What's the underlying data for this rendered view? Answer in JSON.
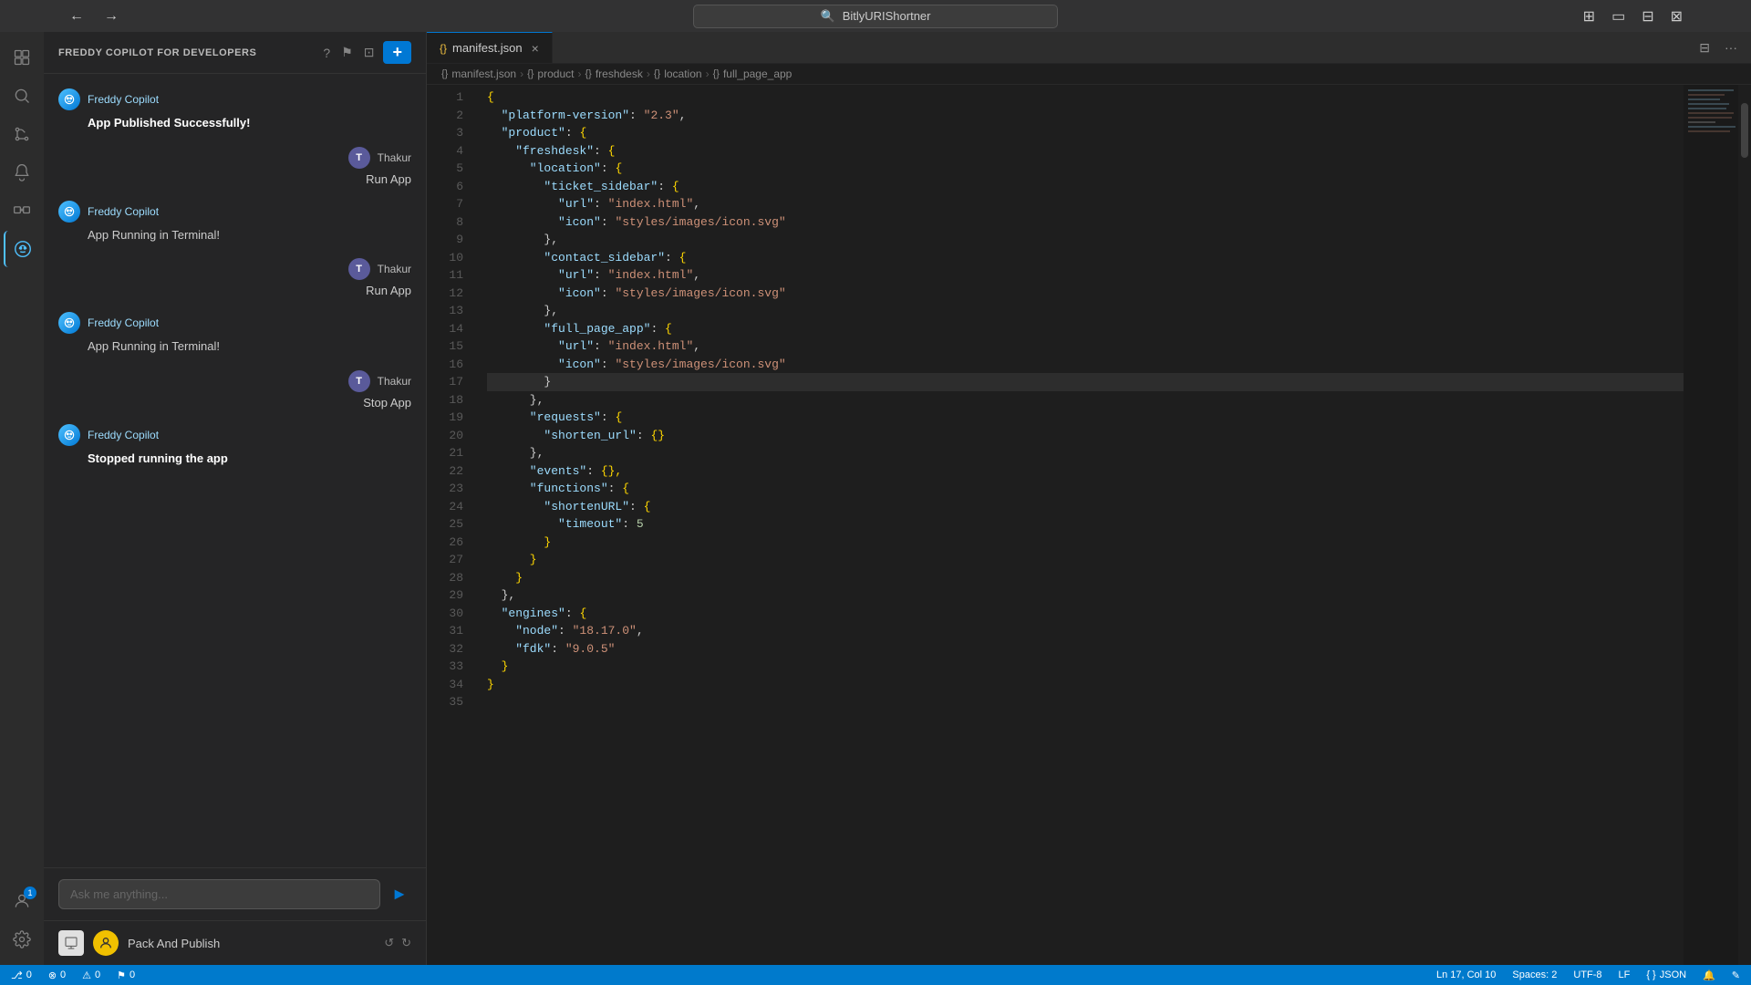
{
  "titlebar": {
    "back_label": "←",
    "forward_label": "→",
    "search_text": "BitlyURIShortner",
    "layout_icons": [
      "⊞",
      "▭",
      "⊟",
      "⊠"
    ]
  },
  "activity_bar": {
    "icons": [
      {
        "name": "explorer",
        "symbol": "⧉",
        "active": false
      },
      {
        "name": "search",
        "symbol": "🔍",
        "active": false
      },
      {
        "name": "source-control",
        "symbol": "⑂",
        "active": false
      },
      {
        "name": "run-debug",
        "symbol": "▷",
        "active": false
      },
      {
        "name": "extensions",
        "symbol": "⊞",
        "active": false
      },
      {
        "name": "copilot",
        "symbol": "◈",
        "active": true
      }
    ],
    "bottom_icons": [
      {
        "name": "accounts",
        "symbol": "👤",
        "badge": "1"
      },
      {
        "name": "settings",
        "symbol": "⚙"
      }
    ]
  },
  "sidebar": {
    "title": "FREDDY COPILOT FOR DEVELOPERS",
    "header_icons": [
      "?",
      "⚑",
      "⊡"
    ],
    "add_button": "+",
    "messages": [
      {
        "type": "bot",
        "avatar": "F",
        "name": "Freddy Copilot",
        "text": "App Published Successfully!",
        "bold": true
      },
      {
        "type": "user",
        "avatar": "T",
        "name": "Thakur",
        "action": "Run App"
      },
      {
        "type": "bot",
        "avatar": "F",
        "name": "Freddy Copilot",
        "text": "App Running in Terminal!",
        "bold": false
      },
      {
        "type": "user",
        "avatar": "T",
        "name": "Thakur",
        "action": "Run App"
      },
      {
        "type": "bot",
        "avatar": "F",
        "name": "Freddy Copilot",
        "text": "App Running in Terminal!",
        "bold": false
      },
      {
        "type": "user",
        "avatar": "T",
        "name": "Thakur",
        "action": "Stop App"
      },
      {
        "type": "bot",
        "avatar": "F",
        "name": "Freddy Copilot",
        "text": "Stopped running the app",
        "bold": true
      }
    ],
    "input_placeholder": "Ask me anything...",
    "pack_label": "Pack And Publish"
  },
  "tab": {
    "icon": "{}",
    "filename": "manifest.json",
    "close": "×"
  },
  "breadcrumb": [
    {
      "icon": "{}",
      "label": "manifest.json"
    },
    {
      "icon": "{}",
      "label": "product"
    },
    {
      "icon": "{}",
      "label": "freshdesk"
    },
    {
      "icon": "{}",
      "label": "location"
    },
    {
      "icon": "{}",
      "label": "full_page_app"
    }
  ],
  "code_lines": [
    {
      "num": 1,
      "content": [
        {
          "t": "brace",
          "v": "{"
        }
      ]
    },
    {
      "num": 2,
      "content": [
        {
          "t": "key",
          "v": "  \"platform-version\""
        },
        {
          "t": "punct",
          "v": ": "
        },
        {
          "t": "string",
          "v": "\"2.3\""
        },
        {
          "t": "punct",
          "v": ","
        }
      ]
    },
    {
      "num": 3,
      "content": [
        {
          "t": "key",
          "v": "  \"product\""
        },
        {
          "t": "punct",
          "v": ": "
        },
        {
          "t": "brace",
          "v": "{"
        }
      ]
    },
    {
      "num": 4,
      "content": [
        {
          "t": "key",
          "v": "    \"freshdesk\""
        },
        {
          "t": "punct",
          "v": ": "
        },
        {
          "t": "brace",
          "v": "{"
        }
      ]
    },
    {
      "num": 5,
      "content": [
        {
          "t": "key",
          "v": "      \"location\""
        },
        {
          "t": "punct",
          "v": ": "
        },
        {
          "t": "brace",
          "v": "{"
        }
      ]
    },
    {
      "num": 6,
      "content": [
        {
          "t": "key",
          "v": "        \"ticket_sidebar\""
        },
        {
          "t": "punct",
          "v": ": "
        },
        {
          "t": "brace",
          "v": "{"
        }
      ]
    },
    {
      "num": 7,
      "content": [
        {
          "t": "key",
          "v": "          \"url\""
        },
        {
          "t": "punct",
          "v": ": "
        },
        {
          "t": "string",
          "v": "\"index.html\""
        },
        {
          "t": "punct",
          "v": ","
        }
      ]
    },
    {
      "num": 8,
      "content": [
        {
          "t": "key",
          "v": "          \"icon\""
        },
        {
          "t": "punct",
          "v": ": "
        },
        {
          "t": "string",
          "v": "\"styles/images/icon.svg\""
        }
      ]
    },
    {
      "num": 9,
      "content": [
        {
          "t": "brace",
          "v": "        "
        },
        {
          "t": "punct",
          "v": "},"
        }
      ]
    },
    {
      "num": 10,
      "content": [
        {
          "t": "key",
          "v": "        \"contact_sidebar\""
        },
        {
          "t": "punct",
          "v": ": "
        },
        {
          "t": "brace",
          "v": "{"
        }
      ]
    },
    {
      "num": 11,
      "content": [
        {
          "t": "key",
          "v": "          \"url\""
        },
        {
          "t": "punct",
          "v": ": "
        },
        {
          "t": "string",
          "v": "\"index.html\""
        },
        {
          "t": "punct",
          "v": ","
        }
      ]
    },
    {
      "num": 12,
      "content": [
        {
          "t": "key",
          "v": "          \"icon\""
        },
        {
          "t": "punct",
          "v": ": "
        },
        {
          "t": "string",
          "v": "\"styles/images/icon.svg\""
        }
      ]
    },
    {
      "num": 13,
      "content": [
        {
          "t": "punct",
          "v": "        },"
        }
      ]
    },
    {
      "num": 14,
      "content": [
        {
          "t": "key",
          "v": "        \"full_page_app\""
        },
        {
          "t": "punct",
          "v": ": "
        },
        {
          "t": "brace",
          "v": "{"
        }
      ]
    },
    {
      "num": 15,
      "content": [
        {
          "t": "key",
          "v": "          \"url\""
        },
        {
          "t": "punct",
          "v": ": "
        },
        {
          "t": "string",
          "v": "\"index.html\""
        },
        {
          "t": "punct",
          "v": ","
        }
      ]
    },
    {
      "num": 16,
      "content": [
        {
          "t": "key",
          "v": "          \"icon\""
        },
        {
          "t": "punct",
          "v": ": "
        },
        {
          "t": "string",
          "v": "\"styles/images/icon.svg\""
        }
      ]
    },
    {
      "num": 17,
      "content": [
        {
          "t": "brace",
          "v": "        "
        },
        {
          "t": "punct",
          "v": "}"
        }
      ]
    },
    {
      "num": 18,
      "content": [
        {
          "t": "punct",
          "v": "      },"
        }
      ]
    },
    {
      "num": 19,
      "content": [
        {
          "t": "key",
          "v": "      \"requests\""
        },
        {
          "t": "punct",
          "v": ": "
        },
        {
          "t": "brace",
          "v": "{"
        }
      ]
    },
    {
      "num": 20,
      "content": [
        {
          "t": "key",
          "v": "        \"shorten_url\""
        },
        {
          "t": "punct",
          "v": ": "
        },
        {
          "t": "brace",
          "v": "{}"
        }
      ]
    },
    {
      "num": 21,
      "content": [
        {
          "t": "punct",
          "v": "      },"
        }
      ]
    },
    {
      "num": 22,
      "content": [
        {
          "t": "key",
          "v": "      \"events\""
        },
        {
          "t": "punct",
          "v": ": "
        },
        {
          "t": "brace",
          "v": "{},"
        }
      ]
    },
    {
      "num": 23,
      "content": [
        {
          "t": "key",
          "v": "      \"functions\""
        },
        {
          "t": "punct",
          "v": ": "
        },
        {
          "t": "brace",
          "v": "{"
        }
      ]
    },
    {
      "num": 24,
      "content": [
        {
          "t": "key",
          "v": "        \"shortenURL\""
        },
        {
          "t": "punct",
          "v": ": "
        },
        {
          "t": "brace",
          "v": "{"
        }
      ]
    },
    {
      "num": 25,
      "content": [
        {
          "t": "key",
          "v": "          \"timeout\""
        },
        {
          "t": "punct",
          "v": ": "
        },
        {
          "t": "number",
          "v": "5"
        }
      ]
    },
    {
      "num": 26,
      "content": [
        {
          "t": "brace",
          "v": "        }"
        }
      ]
    },
    {
      "num": 27,
      "content": [
        {
          "t": "brace",
          "v": "      }"
        }
      ]
    },
    {
      "num": 28,
      "content": [
        {
          "t": "brace",
          "v": "    }"
        }
      ]
    },
    {
      "num": 29,
      "content": [
        {
          "t": "punct",
          "v": "  },"
        }
      ]
    },
    {
      "num": 30,
      "content": [
        {
          "t": "key",
          "v": "  \"engines\""
        },
        {
          "t": "punct",
          "v": ": "
        },
        {
          "t": "brace",
          "v": "{"
        }
      ]
    },
    {
      "num": 31,
      "content": [
        {
          "t": "key",
          "v": "    \"node\""
        },
        {
          "t": "punct",
          "v": ": "
        },
        {
          "t": "string",
          "v": "\"18.17.0\""
        },
        {
          "t": "punct",
          "v": ","
        }
      ]
    },
    {
      "num": 32,
      "content": [
        {
          "t": "key",
          "v": "    \"fdk\""
        },
        {
          "t": "punct",
          "v": ": "
        },
        {
          "t": "string",
          "v": "\"9.0.5\""
        }
      ]
    },
    {
      "num": 33,
      "content": [
        {
          "t": "brace",
          "v": "  }"
        }
      ]
    },
    {
      "num": 34,
      "content": [
        {
          "t": "brace",
          "v": "}"
        }
      ]
    },
    {
      "num": 35,
      "content": []
    }
  ],
  "status_bar": {
    "left": [
      {
        "icon": "⊗",
        "label": "0"
      },
      {
        "icon": "⚠",
        "label": "0"
      },
      {
        "icon": "",
        "label": "0"
      }
    ],
    "right": [
      {
        "label": "Ln 17, Col 10"
      },
      {
        "label": "Spaces: 2"
      },
      {
        "label": "UTF-8"
      },
      {
        "label": "LF"
      },
      {
        "label": "{ } JSON"
      },
      {
        "icon": "🔔"
      },
      {
        "icon": "✎"
      }
    ]
  }
}
